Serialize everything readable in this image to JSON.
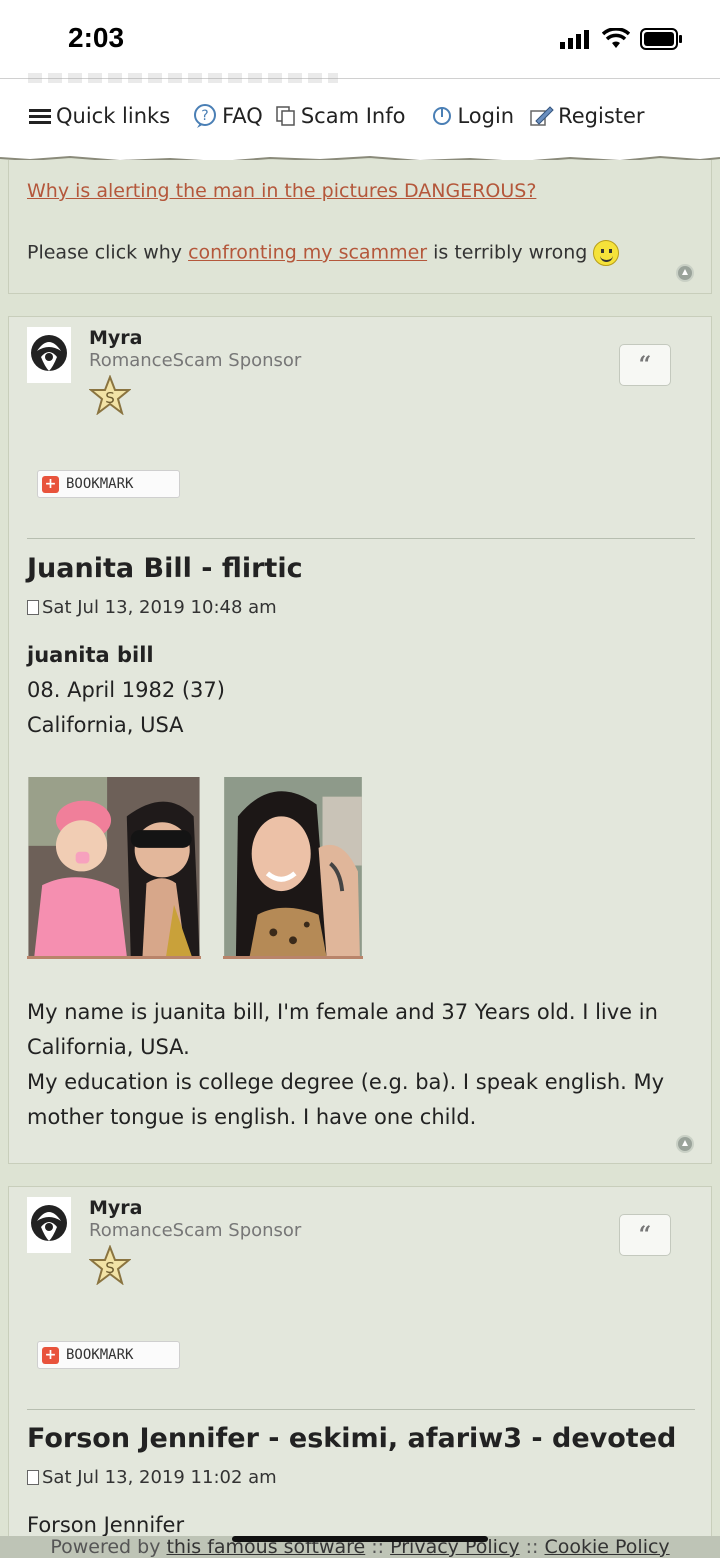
{
  "status_bar": {
    "time": "2:03"
  },
  "nav": {
    "quick_links": "Quick links",
    "faq": "FAQ",
    "scam_info": "Scam Info",
    "login": "Login",
    "register": "Register"
  },
  "notice": {
    "line1": "Why is alerting the man in the pictures DANGEROUS?",
    "line2_prefix": "Please click why ",
    "line2_link": "confronting my scammer",
    "line2_suffix": " is terribly wrong"
  },
  "posts": [
    {
      "author": "Myra",
      "rank": "RomanceScam Sponsor",
      "rank_badge": "S",
      "quote_label": "“",
      "bookmark_label": "BOOKMARK",
      "title": "Juanita Bill - flirtic",
      "date": "Sat Jul 13, 2019 10:48 am",
      "profile_name": "juanita bill",
      "profile_dob": "08. April 1982 (37)",
      "profile_location": "California, USA",
      "body_lines": [
        "My name is juanita bill, I'm female and 37 Years old. I live in",
        "California, USA.",
        "My education is college degree (e.g. ba). I speak english. My",
        "mother tongue is english. I have one child."
      ]
    },
    {
      "author": "Myra",
      "rank": "RomanceScam Sponsor",
      "rank_badge": "S",
      "quote_label": "“",
      "bookmark_label": "BOOKMARK",
      "title": "Forson Jennifer - eskimi, afariw3 - devoted",
      "date": "Sat Jul 13, 2019 11:02 am",
      "profile_name": "Forson Jennifer"
    }
  ],
  "footer": {
    "prefix": "Powered by ",
    "software_link": "this famous software",
    "sep1": " :: ",
    "privacy": "Privacy Policy",
    "sep2": " :: ",
    "cookie": "Cookie Policy"
  },
  "colors": {
    "link": "#b4573b",
    "background": "#dde3d3",
    "post_bg": "#e3e7dc"
  }
}
